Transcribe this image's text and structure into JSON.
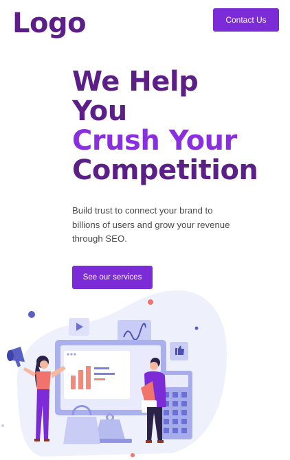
{
  "header": {
    "logo_text": "Logo",
    "contact_label": "Contact Us"
  },
  "hero": {
    "headline_lines": [
      "We Help",
      "You",
      "Crush Your",
      "Competition"
    ],
    "subtitle": "Build trust to connect your brand to billions of users and grow your revenue through SEO.",
    "cta_label": "See our services"
  },
  "colors": {
    "brand_dark": "#5c1f87",
    "brand_accent": "#8a2fe0",
    "button": "#7b2cd6"
  },
  "illustration": {
    "icons": [
      "megaphone-icon",
      "play-icon",
      "wave-chart-icon",
      "thumbs-up-icon",
      "calculator-icon",
      "shopping-bag-icon"
    ]
  }
}
